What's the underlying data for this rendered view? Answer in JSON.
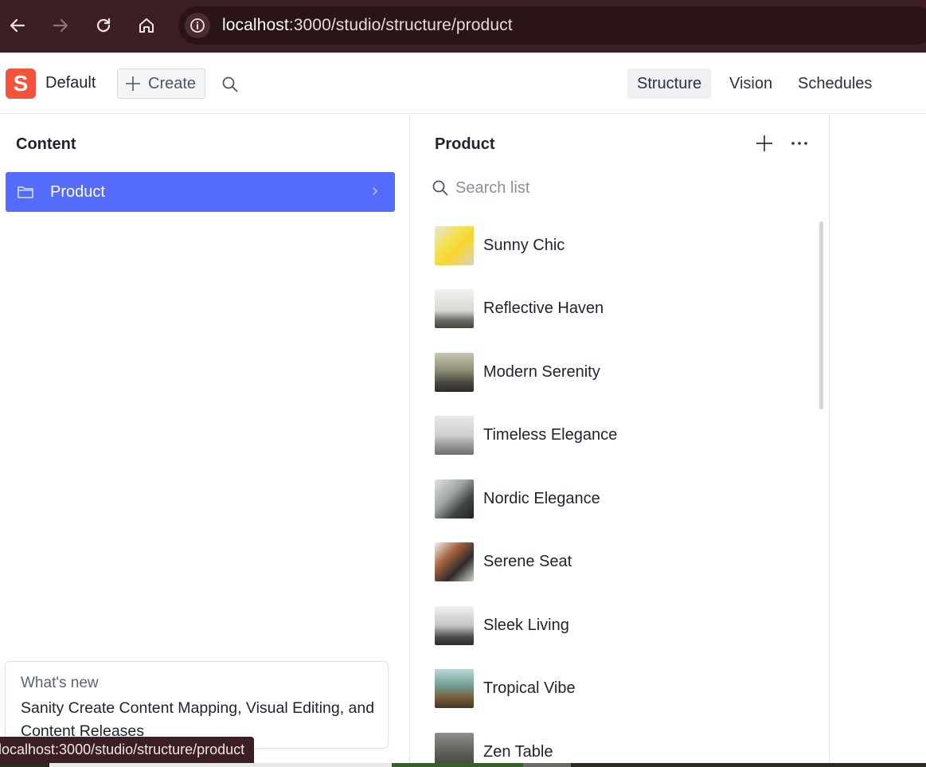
{
  "browser": {
    "url_host": "localhost",
    "url_path": ":3000/studio/structure/product",
    "status_url": "localhost:3000/studio/structure/product"
  },
  "header": {
    "logo_letter": "S",
    "workspace": "Default",
    "create_label": "Create",
    "tools": [
      "Structure",
      "Vision",
      "Schedules"
    ],
    "active_tool": "Structure"
  },
  "content_pane": {
    "title": "Content",
    "items": [
      {
        "label": "Product"
      }
    ]
  },
  "product_pane": {
    "title": "Product",
    "search_placeholder": "Search list",
    "items": [
      {
        "label": "Sunny Chic"
      },
      {
        "label": "Reflective Haven"
      },
      {
        "label": "Modern Serenity"
      },
      {
        "label": "Timeless Elegance"
      },
      {
        "label": "Nordic Elegance"
      },
      {
        "label": "Serene Seat"
      },
      {
        "label": "Sleek Living"
      },
      {
        "label": "Tropical Vibe"
      },
      {
        "label": "Zen Table"
      }
    ]
  },
  "whats_new": {
    "title": "What's new",
    "body": "Sanity Create Content Mapping, Visual Editing, and Content Releases"
  },
  "colors": {
    "accent": "#556bfc",
    "logo": "#f2533d",
    "chrome": "#3b1f22"
  }
}
